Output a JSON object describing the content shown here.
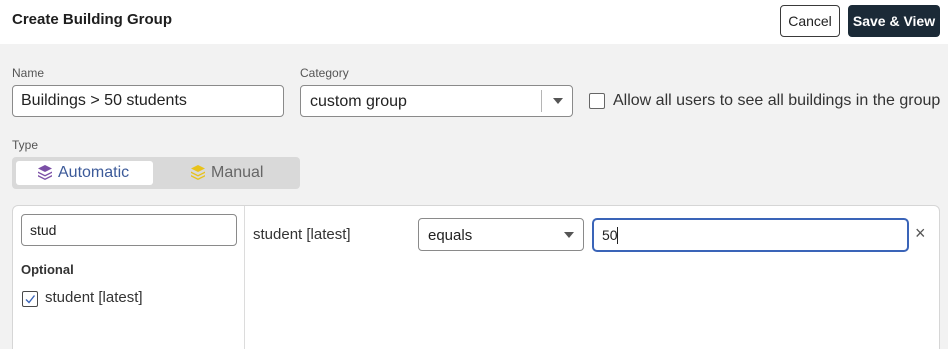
{
  "header": {
    "title": "Create Building Group",
    "cancel_label": "Cancel",
    "save_label": "Save & View"
  },
  "form": {
    "name_label": "Name",
    "name_value": "Buildings > 50 students",
    "category_label": "Category",
    "category_value": "custom group",
    "allow_all_label": "Allow all users to see all buildings in the group",
    "allow_all_checked": false,
    "type_label": "Type",
    "type_options": [
      {
        "label": "Automatic",
        "selected": true,
        "icon": "layers-icon",
        "icon_color": "#7b4fa6"
      },
      {
        "label": "Manual",
        "selected": false,
        "icon": "layers-icon",
        "icon_color": "#e8c21a"
      }
    ]
  },
  "filter": {
    "search_value": "stud",
    "optional_heading": "Optional",
    "options": [
      {
        "label": "student [latest]",
        "checked": true
      }
    ],
    "rule": {
      "field": "student [latest]",
      "operator": "equals",
      "value": "50"
    }
  },
  "colors": {
    "accent": "#3c5a99",
    "primary_button": "#1b2a37",
    "focus_border": "#3a64b8"
  }
}
